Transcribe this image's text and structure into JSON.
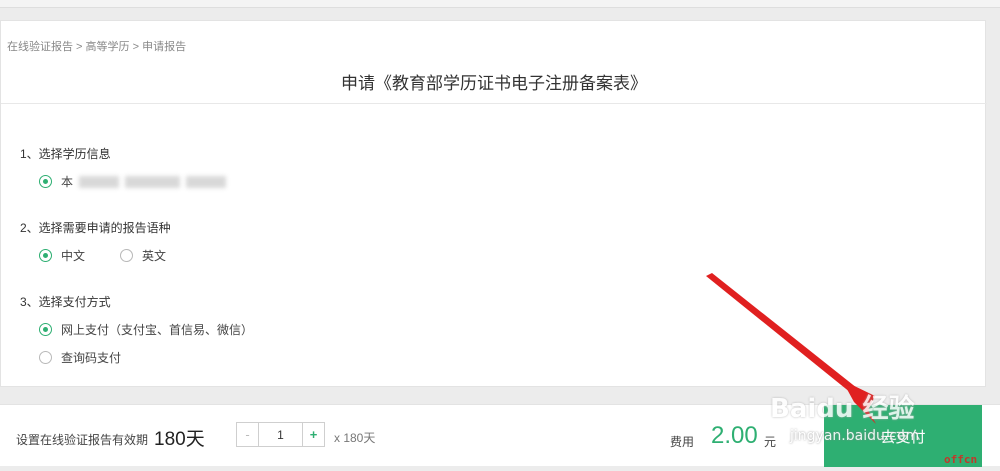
{
  "breadcrumb": "在线验证报告 > 高等学历 > 申请报告",
  "page_title": "申请《教育部学历证书电子注册备案表》",
  "sections": [
    {
      "title": "1、选择学历信息",
      "options": [
        {
          "label": "本",
          "checked": true
        }
      ]
    },
    {
      "title": "2、选择需要申请的报告语种",
      "options": [
        {
          "label": "中文",
          "checked": true
        },
        {
          "label": "英文",
          "checked": false
        }
      ]
    },
    {
      "title": "3、选择支付方式",
      "options": [
        {
          "label": "网上支付（支付宝、首信易、微信）",
          "checked": true
        },
        {
          "label": "查询码支付",
          "checked": false
        }
      ]
    }
  ],
  "footer": {
    "validity_label": "设置在线验证报告有效期",
    "validity_days": "180天",
    "stepper_minus": "-",
    "stepper_value": "1",
    "stepper_plus": "+",
    "multiplier": "x 180天",
    "fee_label": "费用",
    "fee_amount": "2.00",
    "fee_unit": "元",
    "pay_button": "去支付"
  },
  "watermark": {
    "logo_text": "Baidu 经验",
    "url": "jingyan.baidu.com"
  },
  "corner_mark": "offcn",
  "colors": {
    "accent": "#2eaf72",
    "arrow": "#e02020"
  }
}
